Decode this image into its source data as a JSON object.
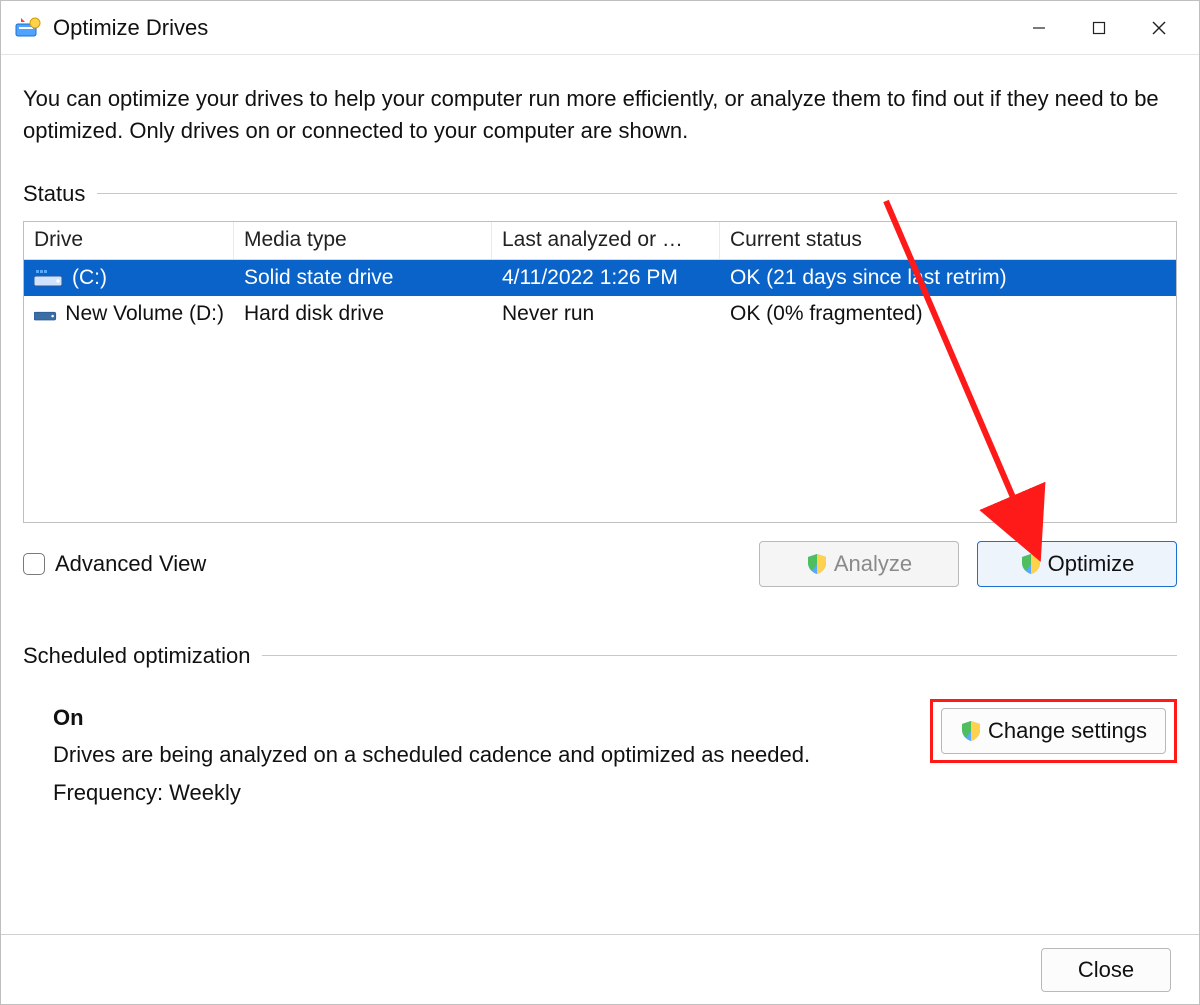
{
  "window": {
    "title": "Optimize Drives"
  },
  "intro": "You can optimize your drives to help your computer run more efficiently, or analyze them to find out if they need to be optimized. Only drives on or connected to your computer are shown.",
  "statusSection": {
    "label": "Status",
    "columns": {
      "drive": "Drive",
      "media": "Media type",
      "last": "Last analyzed or …",
      "status": "Current status"
    },
    "drives": [
      {
        "name": "(C:)",
        "media": "Solid state drive",
        "last": "4/11/2022 1:26 PM",
        "status": "OK (21 days since last retrim)",
        "selected": true,
        "iconVariant": "ssd"
      },
      {
        "name": "New Volume (D:)",
        "media": "Hard disk drive",
        "last": "Never run",
        "status": "OK (0% fragmented)",
        "selected": false,
        "iconVariant": "hdd"
      }
    ],
    "advancedView": "Advanced View",
    "analyze": "Analyze",
    "optimize": "Optimize"
  },
  "scheduled": {
    "label": "Scheduled optimization",
    "state": "On",
    "desc": "Drives are being analyzed on a scheduled cadence and optimized as needed.",
    "freq": "Frequency: Weekly",
    "change": "Change settings"
  },
  "footer": {
    "close": "Close"
  }
}
